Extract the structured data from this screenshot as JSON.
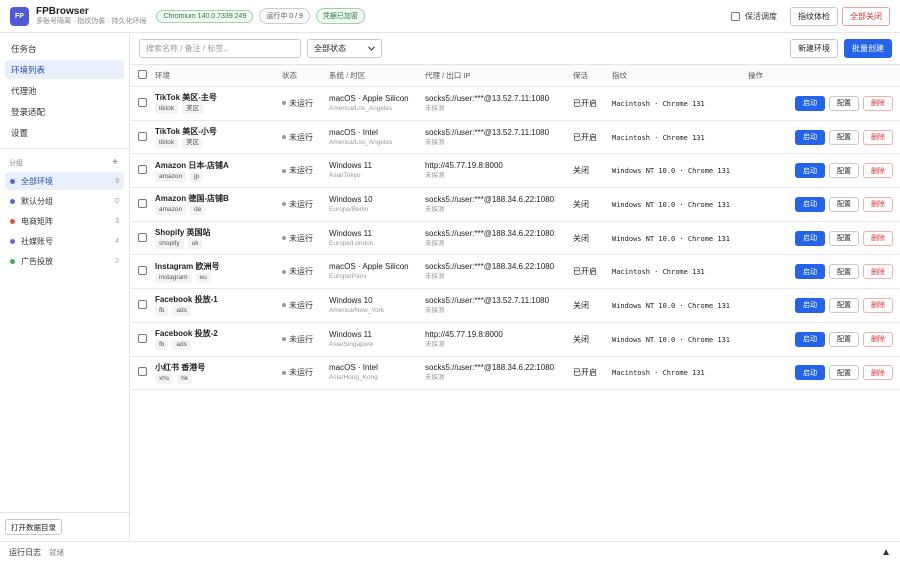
{
  "app": {
    "logo_text": "FP",
    "title": "FPBrowser",
    "subtitle": "多账号隔离 · 指纹伪装 · 持久化环境",
    "chromium_badge": "Chromium 140.0.7339.249",
    "running_badge": "运行中 0 / 9",
    "credentials_badge": "凭据已加密"
  },
  "header": {
    "keepalive_label": "保活调度",
    "fingerprint_check_label": "指纹体检",
    "close_all_label": "全部关闭"
  },
  "sidebar": {
    "nav": [
      {
        "label": "任务台",
        "active": false
      },
      {
        "label": "环境列表",
        "active": true
      },
      {
        "label": "代理池",
        "active": false
      },
      {
        "label": "登录适配",
        "active": false
      },
      {
        "label": "设置",
        "active": false
      }
    ],
    "groups_title": "分组",
    "groups_add": "+",
    "groups": [
      {
        "label": "全部环境",
        "count": "9",
        "color": "#4f6bd5",
        "active": true
      },
      {
        "label": "默认分组",
        "count": "0",
        "color": "#4f6bd5",
        "active": false
      },
      {
        "label": "电商矩阵",
        "count": "3",
        "color": "#e0533a",
        "active": false
      },
      {
        "label": "社媒账号",
        "count": "4",
        "color": "#7b5cd6",
        "active": false
      },
      {
        "label": "广告投放",
        "count": "2",
        "color": "#3fae5c",
        "active": false
      }
    ],
    "open_data_dir_label": "打开数据目录"
  },
  "toolbar": {
    "search_placeholder": "搜索名称 / 备注 / 标签...",
    "status_filter": "全部状态",
    "new_env_label": "新建环境",
    "batch_create_label": "批量创建"
  },
  "table": {
    "columns": {
      "env": "环境",
      "status": "状态",
      "os": "系统 / 时区",
      "proxy": "代理 / 出口 IP",
      "keepalive": "保活",
      "fingerprint": "指纹",
      "actions": "操作"
    },
    "action_labels": {
      "start": "启动",
      "config": "配置",
      "delete": "删除"
    },
    "rows": [
      {
        "name": "TikTok 美区-主号",
        "tags": [
          "tiktok",
          "美区"
        ],
        "status": "未运行",
        "os": "macOS · Apple Silicon",
        "tz": "America/Los_Angeles",
        "proxy": "socks5://user:***@13.52.7.11:1080",
        "probe": "未探测",
        "keepalive": "已开启",
        "fingerprint": "Macintosh · Chrome 131"
      },
      {
        "name": "TikTok 美区-小号",
        "tags": [
          "tiktok",
          "美区"
        ],
        "status": "未运行",
        "os": "macOS · Intel",
        "tz": "America/Los_Angeles",
        "proxy": "socks5://user:***@13.52.7.11:1080",
        "probe": "未探测",
        "keepalive": "已开启",
        "fingerprint": "Macintosh · Chrome 131"
      },
      {
        "name": "Amazon 日本-店铺A",
        "tags": [
          "amazon",
          "jp"
        ],
        "status": "未运行",
        "os": "Windows 11",
        "tz": "Asia/Tokyo",
        "proxy": "http://45.77.19.8:8000",
        "probe": "未探测",
        "keepalive": "关闭",
        "fingerprint": "Windows NT 10.0 · Chrome 131"
      },
      {
        "name": "Amazon 德国-店铺B",
        "tags": [
          "amazon",
          "de"
        ],
        "status": "未运行",
        "os": "Windows 10",
        "tz": "Europe/Berlin",
        "proxy": "socks5://user:***@188.34.6.22:1080",
        "probe": "未探测",
        "keepalive": "关闭",
        "fingerprint": "Windows NT 10.0 · Chrome 131"
      },
      {
        "name": "Shopify 英国站",
        "tags": [
          "shopify",
          "uk"
        ],
        "status": "未运行",
        "os": "Windows 11",
        "tz": "Europe/London",
        "proxy": "socks5://user:***@188.34.6.22:1080",
        "probe": "未探测",
        "keepalive": "关闭",
        "fingerprint": "Windows NT 10.0 · Chrome 131"
      },
      {
        "name": "Instagram 欧洲号",
        "tags": [
          "instagram",
          "eu"
        ],
        "status": "未运行",
        "os": "macOS · Apple Silicon",
        "tz": "Europe/Paris",
        "proxy": "socks5://user:***@188.34.6.22:1080",
        "probe": "未探测",
        "keepalive": "已开启",
        "fingerprint": "Macintosh · Chrome 131"
      },
      {
        "name": "Facebook 投放-1",
        "tags": [
          "fb",
          "ads"
        ],
        "status": "未运行",
        "os": "Windows 10",
        "tz": "America/New_York",
        "proxy": "socks5://user:***@13.52.7.11:1080",
        "probe": "未探测",
        "keepalive": "关闭",
        "fingerprint": "Windows NT 10.0 · Chrome 131"
      },
      {
        "name": "Facebook 投放-2",
        "tags": [
          "fb",
          "ads"
        ],
        "status": "未运行",
        "os": "Windows 11",
        "tz": "Asia/Singapore",
        "proxy": "http://45.77.19.8:8000",
        "probe": "未探测",
        "keepalive": "关闭",
        "fingerprint": "Windows NT 10.0 · Chrome 131"
      },
      {
        "name": "小红书 香港号",
        "tags": [
          "xhs",
          "hk"
        ],
        "status": "未运行",
        "os": "macOS · Intel",
        "tz": "Asia/Hong_Kong",
        "proxy": "socks5://user:***@188.34.6.22:1080",
        "probe": "未探测",
        "keepalive": "已开启",
        "fingerprint": "Macintosh · Chrome 131"
      }
    ]
  },
  "bottombar": {
    "log_label": "运行日志",
    "log_status": "就绪",
    "expand_icon": "▲"
  }
}
